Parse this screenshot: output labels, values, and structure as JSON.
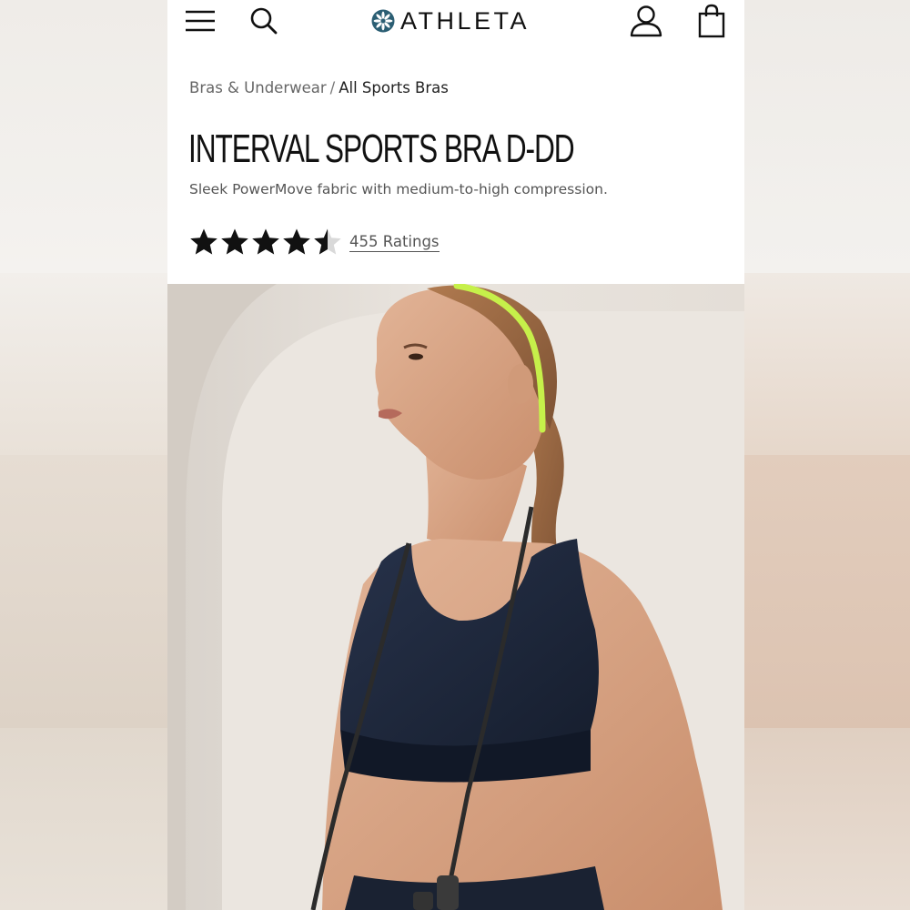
{
  "header": {
    "brand": "ATHLETA",
    "menu_icon": "hamburger-menu-icon",
    "search_icon": "search-icon",
    "account_icon": "account-icon",
    "bag_icon": "shopping-bag-icon"
  },
  "breadcrumb": {
    "parent": "Bras & Underwear",
    "separator": "/",
    "current": "All Sports Bras"
  },
  "product": {
    "title": "INTERVAL SPORTS BRA D-DD",
    "subtitle": "Sleek PowerMove fabric with medium-to-high compression.",
    "rating": 4.5,
    "rating_max": 5,
    "ratings_label": "455 Ratings"
  },
  "colors": {
    "background": "#ffffff",
    "text_primary": "#111111",
    "text_secondary": "#555555",
    "star": "#111111",
    "logo_accent": "#2b5e73",
    "headband": "#c6f04a",
    "bra": "#1c2536"
  }
}
